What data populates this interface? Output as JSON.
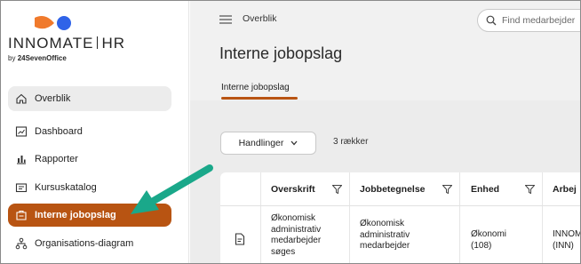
{
  "brand": {
    "name_left": "INNOMATE",
    "name_right": "HR",
    "by_text": "by",
    "company": "24SevenOffice",
    "colors": {
      "orange": "#f07a2c",
      "blue": "#2f63e8",
      "accent": "#b85412"
    }
  },
  "sidebar": {
    "items": [
      {
        "label": "Overblik",
        "icon": "home-icon"
      },
      {
        "label": "Dashboard",
        "icon": "dashboard-icon"
      },
      {
        "label": "Rapporter",
        "icon": "chart-icon"
      },
      {
        "label": "Kursuskatalog",
        "icon": "catalog-icon"
      },
      {
        "label": "Interne jobopslag",
        "icon": "job-posting-icon",
        "active": true
      },
      {
        "label": "Organisations-diagram",
        "icon": "org-chart-icon"
      }
    ]
  },
  "topbar": {
    "breadcrumb": "Overblik",
    "search_placeholder": "Find medarbejder"
  },
  "page": {
    "title": "Interne jobopslag",
    "tabs": [
      {
        "label": "Interne jobopslag",
        "active": true
      }
    ]
  },
  "toolbar": {
    "actions_label": "Handlinger",
    "row_count": "3 rækker"
  },
  "table": {
    "columns": [
      "Overskrift",
      "Jobbetegnelse",
      "Enhed",
      "Arbej"
    ],
    "rows": [
      {
        "overskrift": [
          "Økonomisk",
          "administrativ",
          "medarbejder",
          "søges"
        ],
        "jobbetegnelse": [
          "Økonomisk",
          "administrativ",
          "medarbejder"
        ],
        "enhed": [
          "Økonomi",
          "(108)"
        ],
        "arbejde": [
          "INNOM",
          "(INN)"
        ]
      }
    ]
  },
  "annotation": {
    "arrow_color": "#1aa88a"
  }
}
